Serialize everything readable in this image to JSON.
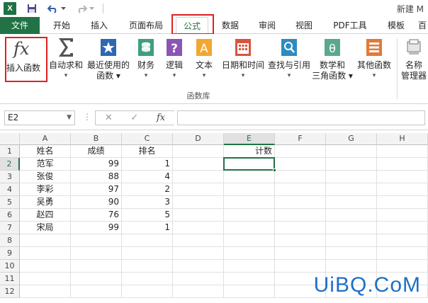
{
  "titlebar": {
    "logo_text": "X",
    "title": "新建 M"
  },
  "tabs": [
    {
      "label": "文件"
    },
    {
      "label": "开始"
    },
    {
      "label": "插入"
    },
    {
      "label": "页面布局"
    },
    {
      "label": "公式"
    },
    {
      "label": "数据"
    },
    {
      "label": "审阅"
    },
    {
      "label": "视图"
    },
    {
      "label": "PDF工具"
    },
    {
      "label": "模板"
    },
    {
      "label": "百"
    }
  ],
  "active_tab": "公式",
  "ribbon": {
    "buttons": [
      {
        "icon": "fx-icon",
        "line1": "插入函数",
        "line2": ""
      },
      {
        "icon": "sigma-icon",
        "line1": "自动求和",
        "line2": "▾"
      },
      {
        "icon": "star-icon",
        "line1": "最近使用的",
        "line2": "函数 ▾"
      },
      {
        "icon": "finance-icon",
        "line1": "财务",
        "line2": "▾"
      },
      {
        "icon": "question-icon",
        "line1": "逻辑",
        "line2": "▾"
      },
      {
        "icon": "text-A-icon",
        "line1": "文本",
        "line2": "▾"
      },
      {
        "icon": "calendar-icon",
        "line1": "日期和时间",
        "line2": "▾"
      },
      {
        "icon": "lookup-icon",
        "line1": "查找与引用",
        "line2": "▾"
      },
      {
        "icon": "theta-icon",
        "line1": "数学和",
        "line2": "三角函数 ▾"
      },
      {
        "icon": "more-functions-icon",
        "line1": "其他函数",
        "line2": "▾"
      },
      {
        "icon": "name-manager-icon",
        "line1": "名称",
        "line2": "管理器"
      }
    ],
    "group_label": "函数库"
  },
  "formula_bar": {
    "name_box": "E2",
    "cancel_symbol": "✕",
    "enter_symbol": "✓",
    "fx_symbol": "fx",
    "value": ""
  },
  "sheet": {
    "columns": [
      "A",
      "B",
      "C",
      "D",
      "E",
      "F",
      "G",
      "H"
    ],
    "rows": [
      "1",
      "2",
      "3",
      "4",
      "5",
      "6",
      "7",
      "8",
      "9",
      "10",
      "11",
      "12"
    ],
    "cells": [
      [
        "姓名",
        "成绩",
        "排名",
        "",
        "计数"
      ],
      [
        "范军",
        "99",
        "1",
        "",
        ""
      ],
      [
        "张俊",
        "88",
        "4",
        "",
        ""
      ],
      [
        "李彩",
        "97",
        "2",
        "",
        ""
      ],
      [
        "吴勇",
        "90",
        "3",
        "",
        ""
      ],
      [
        "赵四",
        "76",
        "5",
        "",
        ""
      ],
      [
        "宋局",
        "99",
        "1",
        "",
        ""
      ]
    ],
    "selected_cell": "E2"
  },
  "watermark": "UiBQ.CoM",
  "colors": {
    "excel_green": "#217346",
    "highlight_red": "#e02020",
    "watermark_blue": "#1e6fc8"
  }
}
